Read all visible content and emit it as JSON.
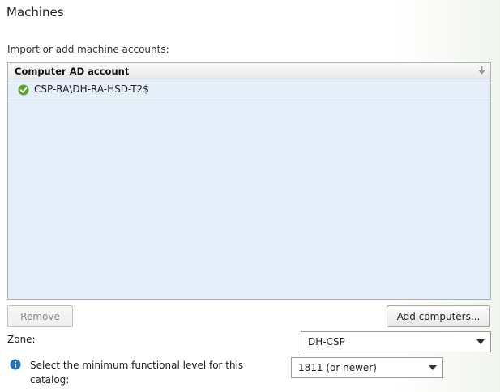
{
  "section": {
    "title": "Machines",
    "subtitle": "Import or add machine accounts:"
  },
  "grid": {
    "column_header": "Computer AD account",
    "rows": [
      {
        "status_icon": "check-circle-icon",
        "account": "CSP-RA\\DH-RA-HSD-T2$"
      }
    ]
  },
  "buttons": {
    "remove": "Remove",
    "add_computers": "Add computers..."
  },
  "zone": {
    "label": "Zone:",
    "selected": "DH-CSP"
  },
  "functional_level": {
    "label": "Select the minimum functional level for this catalog:",
    "selected": "1811 (or newer)"
  },
  "colors": {
    "grid_background": "#e4eff9",
    "check_green": "#5aa42d",
    "info_blue": "#1e73c8"
  }
}
